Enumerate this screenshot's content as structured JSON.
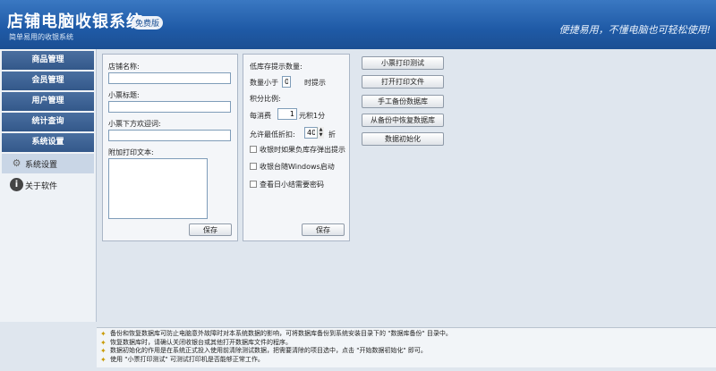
{
  "header": {
    "title": "店铺电脑收银系统",
    "edition": "免费版",
    "subtitle": "简单易用的收银系统",
    "slogan": "便捷易用，不懂电脑也可轻松使用!"
  },
  "sidebar": {
    "categories": [
      "商品管理",
      "会员管理",
      "用户管理",
      "统计查询",
      "系统设置"
    ],
    "sub_items": [
      {
        "label": "系统设置",
        "icon": "gear-icon"
      },
      {
        "label": "关于软件",
        "icon": "info-icon"
      }
    ]
  },
  "receipt_panel": {
    "shop_name_label": "店铺名称:",
    "shop_name_value": "",
    "title_label": "小票标题:",
    "title_value": "",
    "welcome_label": "小票下方欢迎词:",
    "welcome_value": "",
    "extra_label": "附加打印文本:",
    "extra_value": "",
    "save_label": "保存"
  },
  "settings_panel": {
    "low_stock_label": "低库存提示数量:",
    "qty_prefix": "数量小于",
    "qty_value": "0",
    "qty_suffix": "时提示",
    "points_label": "积分比例:",
    "points_prefix": "每消费",
    "points_value": "1",
    "points_suffix": "元积1分",
    "discount_label": "允许最低折扣:",
    "discount_value": "40",
    "discount_suffix": "折",
    "check_stock_popup": "收银时如果负库存弹出提示",
    "check_start_with_windows": "收银台随Windows启动",
    "check_daily_password": "查看日小结需要密码",
    "save_label": "保存"
  },
  "actions": {
    "test_print": "小票打印测试",
    "open_print_file": "打开打印文件",
    "backup_db": "手工备份数据库",
    "restore_db": "从备份中恢复数据库",
    "init_data": "数据初始化"
  },
  "notes": [
    "备份和恢复数据库可防止电脑意外故障时对本系统数据的影响，可将数据库备份到系统安装目录下的 \"数据库备份\" 目录中。",
    "恢复数据库时，请确认关闭收银台或其他打开数据库文件的程序。",
    "数据初始化的作用是在系统正式投入使用前清除测试数据，把需要清除的项目选中，点击 \"开始数据初始化\" 即可。",
    "使用 \"小票打印测试\" 可测试打印机是否能够正常工作。"
  ],
  "colors": {
    "header": "#1f5aa6",
    "sidebar_category": "#3d6496",
    "panel_bg": "#f4f6f9"
  }
}
